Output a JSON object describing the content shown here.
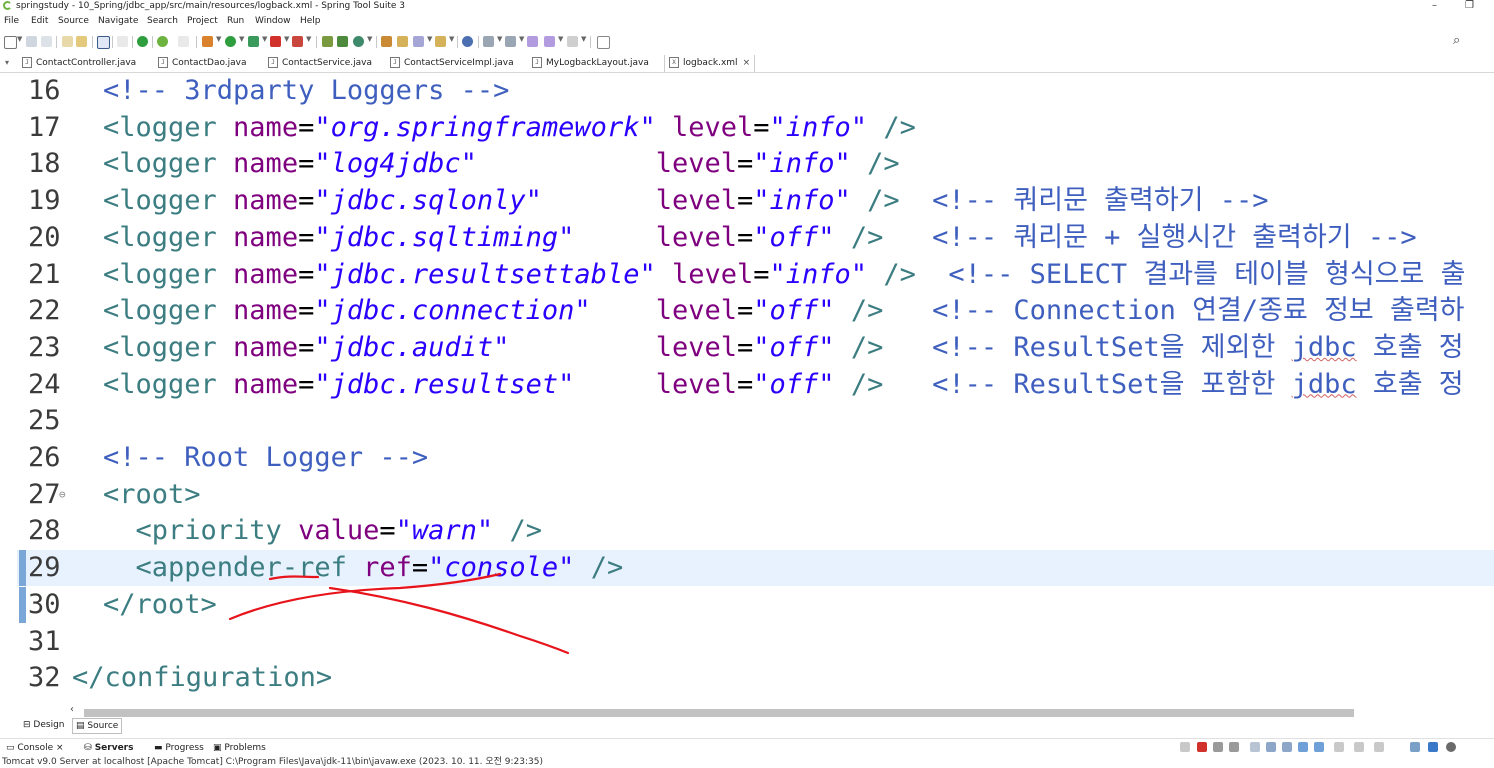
{
  "window": {
    "title": "springstudy - 10_Spring/jdbc_app/src/main/resources/logback.xml - Spring Tool Suite 3",
    "minimize": "–",
    "restore": "❐"
  },
  "menu": [
    "File",
    "Edit",
    "Source",
    "Navigate",
    "Search",
    "Project",
    "Run",
    "Window",
    "Help"
  ],
  "tabs": [
    {
      "label": "ContactController.java",
      "icon": "J",
      "active": false
    },
    {
      "label": "ContactDao.java",
      "icon": "J",
      "active": false
    },
    {
      "label": "ContactService.java",
      "icon": "J",
      "active": false
    },
    {
      "label": "ContactServiceImpl.java",
      "icon": "J",
      "active": false
    },
    {
      "label": "MyLogbackLayout.java",
      "icon": "J",
      "active": false
    },
    {
      "label": "logback.xml",
      "icon": "X",
      "active": true,
      "close": "×"
    }
  ],
  "editor": {
    "lines": [
      {
        "num": "16",
        "segments": [
          [
            "com",
            "<!-- 3rdparty Loggers -->"
          ]
        ]
      },
      {
        "num": "17",
        "segments": [
          [
            "tag",
            "<logger "
          ],
          [
            "attr",
            "name"
          ],
          [
            "plain",
            "="
          ],
          [
            "val",
            "\"org.springframework\""
          ],
          [
            "plain",
            " "
          ],
          [
            "attr",
            "level"
          ],
          [
            "plain",
            "="
          ],
          [
            "val",
            "\"info\""
          ],
          [
            "plain",
            " "
          ],
          [
            "tag",
            "/>"
          ]
        ]
      },
      {
        "num": "18",
        "segments": [
          [
            "tag",
            "<logger "
          ],
          [
            "attr",
            "name"
          ],
          [
            "plain",
            "="
          ],
          [
            "val",
            "\"log4jdbc\""
          ],
          [
            "plain",
            "           "
          ],
          [
            "attr",
            "level"
          ],
          [
            "plain",
            "="
          ],
          [
            "val",
            "\"info\""
          ],
          [
            "plain",
            " "
          ],
          [
            "tag",
            "/>"
          ]
        ]
      },
      {
        "num": "19",
        "segments": [
          [
            "tag",
            "<logger "
          ],
          [
            "attr",
            "name"
          ],
          [
            "plain",
            "="
          ],
          [
            "val",
            "\"jdbc.sqlonly\""
          ],
          [
            "plain",
            "       "
          ],
          [
            "attr",
            "level"
          ],
          [
            "plain",
            "="
          ],
          [
            "val",
            "\"info\""
          ],
          [
            "plain",
            " "
          ],
          [
            "tag",
            "/>"
          ],
          [
            "plain",
            "  "
          ],
          [
            "com",
            "<!-- 쿼리문 출력하기 -->"
          ]
        ]
      },
      {
        "num": "20",
        "segments": [
          [
            "tag",
            "<logger "
          ],
          [
            "attr",
            "name"
          ],
          [
            "plain",
            "="
          ],
          [
            "val",
            "\"jdbc.sqltiming\""
          ],
          [
            "plain",
            "     "
          ],
          [
            "attr",
            "level"
          ],
          [
            "plain",
            "="
          ],
          [
            "val",
            "\"off\""
          ],
          [
            "plain",
            " "
          ],
          [
            "tag",
            "/>"
          ],
          [
            "plain",
            "   "
          ],
          [
            "com",
            "<!-- 쿼리문 + 실행시간 출력하기 -->"
          ]
        ]
      },
      {
        "num": "21",
        "segments": [
          [
            "tag",
            "<logger "
          ],
          [
            "attr",
            "name"
          ],
          [
            "plain",
            "="
          ],
          [
            "val",
            "\"jdbc.resultsettable\""
          ],
          [
            "plain",
            " "
          ],
          [
            "attr",
            "level"
          ],
          [
            "plain",
            "="
          ],
          [
            "val",
            "\"info\""
          ],
          [
            "plain",
            " "
          ],
          [
            "tag",
            "/>"
          ],
          [
            "plain",
            "  "
          ],
          [
            "com",
            "<!-- SELECT 결과를 테이블 형식으로 출"
          ]
        ]
      },
      {
        "num": "22",
        "segments": [
          [
            "tag",
            "<logger "
          ],
          [
            "attr",
            "name"
          ],
          [
            "plain",
            "="
          ],
          [
            "val",
            "\"jdbc.connection\""
          ],
          [
            "plain",
            "    "
          ],
          [
            "attr",
            "level"
          ],
          [
            "plain",
            "="
          ],
          [
            "val",
            "\"off\""
          ],
          [
            "plain",
            " "
          ],
          [
            "tag",
            "/>"
          ],
          [
            "plain",
            "   "
          ],
          [
            "com",
            "<!-- Connection 연결/종료 정보 출력하"
          ]
        ]
      },
      {
        "num": "23",
        "segments": [
          [
            "tag",
            "<logger "
          ],
          [
            "attr",
            "name"
          ],
          [
            "plain",
            "="
          ],
          [
            "val",
            "\"jdbc.audit\""
          ],
          [
            "plain",
            "         "
          ],
          [
            "attr",
            "level"
          ],
          [
            "plain",
            "="
          ],
          [
            "val",
            "\"off\""
          ],
          [
            "plain",
            " "
          ],
          [
            "tag",
            "/>"
          ],
          [
            "plain",
            "   "
          ],
          [
            "com",
            "<!-- ResultSet을 제외한 "
          ],
          [
            "comsq",
            "jdbc"
          ],
          [
            "com",
            " 호출 정"
          ]
        ]
      },
      {
        "num": "24",
        "segments": [
          [
            "tag",
            "<logger "
          ],
          [
            "attr",
            "name"
          ],
          [
            "plain",
            "="
          ],
          [
            "val",
            "\"jdbc.resultset\""
          ],
          [
            "plain",
            "     "
          ],
          [
            "attr",
            "level"
          ],
          [
            "plain",
            "="
          ],
          [
            "val",
            "\"off\""
          ],
          [
            "plain",
            " "
          ],
          [
            "tag",
            "/>"
          ],
          [
            "plain",
            "   "
          ],
          [
            "com",
            "<!-- ResultSet을 포함한 "
          ],
          [
            "comsq",
            "jdbc"
          ],
          [
            "com",
            " 호출 정"
          ]
        ]
      },
      {
        "num": "25",
        "segments": []
      },
      {
        "num": "26",
        "segments": [
          [
            "com",
            "<!-- Root Logger -->"
          ]
        ]
      },
      {
        "num": "27",
        "segments": [
          [
            "tag",
            "<root>"
          ]
        ],
        "fold": "⊖"
      },
      {
        "num": "28",
        "segments": [
          [
            "plain",
            "  "
          ],
          [
            "tag",
            "<priority "
          ],
          [
            "attr",
            "value"
          ],
          [
            "plain",
            "="
          ],
          [
            "val",
            "\"warn\""
          ],
          [
            "plain",
            " "
          ],
          [
            "tag",
            "/>"
          ]
        ]
      },
      {
        "num": "29",
        "segments": [
          [
            "plain",
            "  "
          ],
          [
            "tag",
            "<appender-ref "
          ],
          [
            "attr",
            "ref"
          ],
          [
            "plain",
            "="
          ],
          [
            "val",
            "\"console\""
          ],
          [
            "plain",
            " "
          ],
          [
            "tag",
            "/>"
          ]
        ],
        "current": true
      },
      {
        "num": "30",
        "segments": [
          [
            "tag",
            "</root>"
          ]
        ]
      },
      {
        "num": "31",
        "segments": []
      },
      {
        "num": "32",
        "segments": [
          [
            "tag",
            "</configuration>"
          ]
        ],
        "outdent": true
      }
    ]
  },
  "bottom_tabs": [
    {
      "label": "Design",
      "icon": "⊟"
    },
    {
      "label": "Source",
      "icon": "▤",
      "active": true
    }
  ],
  "console_tabs": [
    {
      "label": "Console",
      "close": "×"
    },
    {
      "label": "Servers",
      "bold": true
    },
    {
      "label": "Progress"
    },
    {
      "label": "Problems"
    }
  ],
  "console_status": "Tomcat v9.0 Server at localhost [Apache Tomcat] C:\\Program Files\\Java\\jdk-11\\bin\\javaw.exe  (2023. 10. 11. 오전 9:23:35)",
  "colors": {
    "comment": "#3f5fbf",
    "tag": "#3c7d82",
    "attribute": "#7f007f",
    "value": "#2a00ff",
    "current_line": "#e8f2fe",
    "annotation_ink": "#e8141c"
  }
}
